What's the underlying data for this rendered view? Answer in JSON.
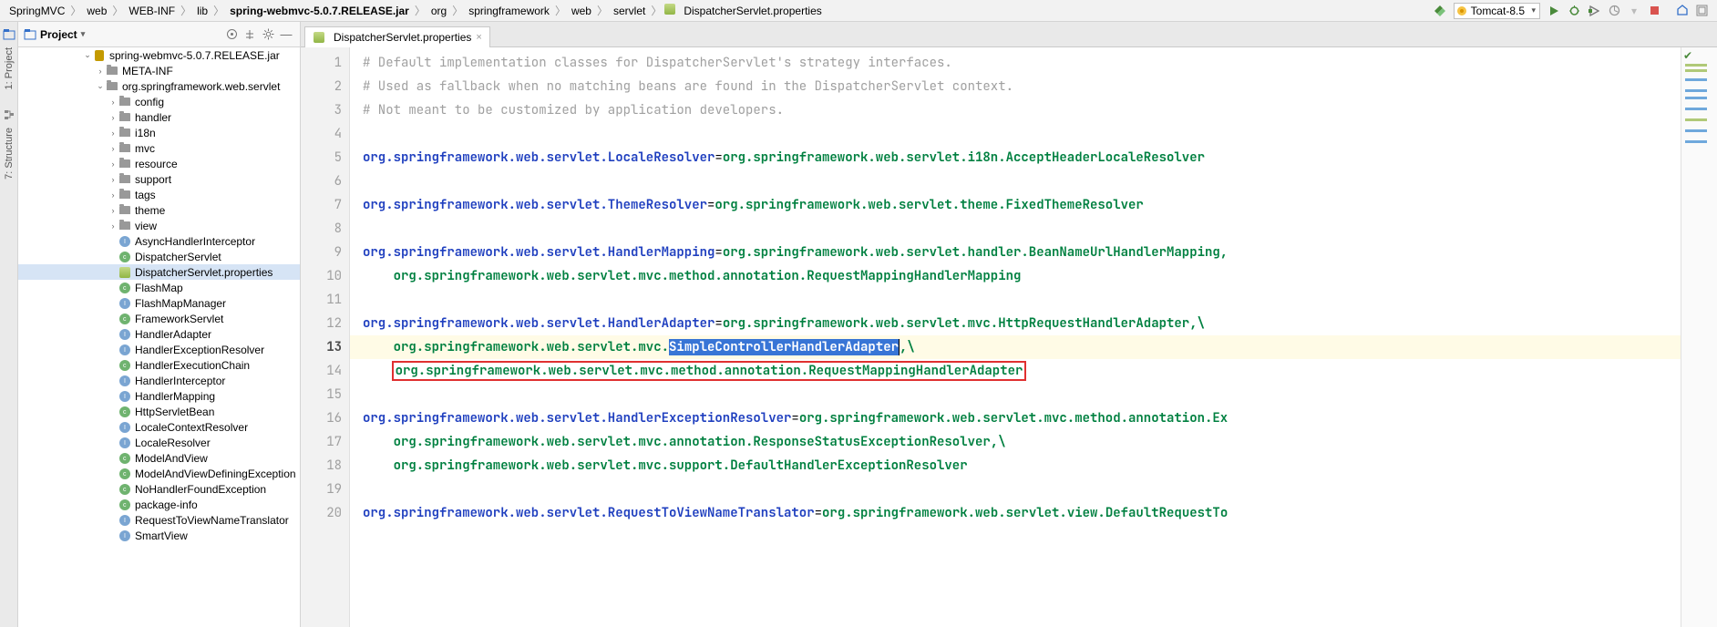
{
  "breadcrumb": [
    "SpringMVC",
    "web",
    "WEB-INF",
    "lib",
    "spring-webmvc-5.0.7.RELEASE.jar",
    "org",
    "springframework",
    "web",
    "servlet",
    "DispatcherServlet.properties"
  ],
  "breadcrumb_bold_index": 4,
  "run_config": "Tomcat-8.5",
  "sidebar": {
    "title": "Project",
    "vtabs": [
      "1: Project",
      "7: Structure"
    ],
    "tree": [
      {
        "d": 5,
        "tw": "v",
        "ico": "jar",
        "lbl": "spring-webmvc-5.0.7.RELEASE.jar"
      },
      {
        "d": 6,
        "tw": ">",
        "ico": "folder",
        "lbl": "META-INF"
      },
      {
        "d": 6,
        "tw": "v",
        "ico": "folder",
        "lbl": "org.springframework.web.servlet"
      },
      {
        "d": 7,
        "tw": ">",
        "ico": "folder",
        "lbl": "config"
      },
      {
        "d": 7,
        "tw": ">",
        "ico": "folder",
        "lbl": "handler"
      },
      {
        "d": 7,
        "tw": ">",
        "ico": "folder",
        "lbl": "i18n"
      },
      {
        "d": 7,
        "tw": ">",
        "ico": "folder",
        "lbl": "mvc"
      },
      {
        "d": 7,
        "tw": ">",
        "ico": "folder",
        "lbl": "resource"
      },
      {
        "d": 7,
        "tw": ">",
        "ico": "folder",
        "lbl": "support"
      },
      {
        "d": 7,
        "tw": ">",
        "ico": "folder",
        "lbl": "tags"
      },
      {
        "d": 7,
        "tw": ">",
        "ico": "folder",
        "lbl": "theme"
      },
      {
        "d": 7,
        "tw": ">",
        "ico": "folder",
        "lbl": "view"
      },
      {
        "d": 7,
        "tw": "",
        "ico": "clsi",
        "lbl": "AsyncHandlerInterceptor"
      },
      {
        "d": 7,
        "tw": "",
        "ico": "cls",
        "lbl": "DispatcherServlet"
      },
      {
        "d": 7,
        "tw": "",
        "ico": "props",
        "lbl": "DispatcherServlet.properties",
        "sel": true
      },
      {
        "d": 7,
        "tw": "",
        "ico": "cls",
        "lbl": "FlashMap"
      },
      {
        "d": 7,
        "tw": "",
        "ico": "clsi",
        "lbl": "FlashMapManager"
      },
      {
        "d": 7,
        "tw": "",
        "ico": "cls",
        "lbl": "FrameworkServlet"
      },
      {
        "d": 7,
        "tw": "",
        "ico": "clsi",
        "lbl": "HandlerAdapter"
      },
      {
        "d": 7,
        "tw": "",
        "ico": "clsi",
        "lbl": "HandlerExceptionResolver"
      },
      {
        "d": 7,
        "tw": "",
        "ico": "cls",
        "lbl": "HandlerExecutionChain"
      },
      {
        "d": 7,
        "tw": "",
        "ico": "clsi",
        "lbl": "HandlerInterceptor"
      },
      {
        "d": 7,
        "tw": "",
        "ico": "clsi",
        "lbl": "HandlerMapping"
      },
      {
        "d": 7,
        "tw": "",
        "ico": "cls",
        "lbl": "HttpServletBean"
      },
      {
        "d": 7,
        "tw": "",
        "ico": "clsi",
        "lbl": "LocaleContextResolver"
      },
      {
        "d": 7,
        "tw": "",
        "ico": "clsi",
        "lbl": "LocaleResolver"
      },
      {
        "d": 7,
        "tw": "",
        "ico": "cls",
        "lbl": "ModelAndView"
      },
      {
        "d": 7,
        "tw": "",
        "ico": "cls",
        "lbl": "ModelAndViewDefiningException"
      },
      {
        "d": 7,
        "tw": "",
        "ico": "cls",
        "lbl": "NoHandlerFoundException"
      },
      {
        "d": 7,
        "tw": "",
        "ico": "cls",
        "lbl": "package-info"
      },
      {
        "d": 7,
        "tw": "",
        "ico": "clsi",
        "lbl": "RequestToViewNameTranslator"
      },
      {
        "d": 7,
        "tw": "",
        "ico": "clsi",
        "lbl": "SmartView"
      }
    ]
  },
  "editor": {
    "tab_label": "DispatcherServlet.properties",
    "current_line": 13,
    "lines": [
      {
        "n": 1,
        "cmt": "# Default implementation classes for DispatcherServlet's strategy interfaces."
      },
      {
        "n": 2,
        "cmt": "# Used as fallback when no matching beans are found in the DispatcherServlet context."
      },
      {
        "n": 3,
        "cmt": "# Not meant to be customized by application developers."
      },
      {
        "n": 4,
        "blank": true
      },
      {
        "n": 5,
        "key": "org.springframework.web.servlet.LocaleResolver",
        "eq": "=",
        "val": "org.springframework.web.servlet.i18n.AcceptHeaderLocaleResolver"
      },
      {
        "n": 6,
        "blank": true
      },
      {
        "n": 7,
        "key": "org.springframework.web.servlet.ThemeResolver",
        "eq": "=",
        "val": "org.springframework.web.servlet.theme.FixedThemeResolver"
      },
      {
        "n": 8,
        "blank": true
      },
      {
        "n": 9,
        "key": "org.springframework.web.servlet.HandlerMapping",
        "eq": "=",
        "val": "org.springframework.web.servlet.handler.BeanNameUrlHandlerMapping,"
      },
      {
        "n": 10,
        "cont": true,
        "val": "org.springframework.web.servlet.mvc.method.annotation.RequestMappingHandlerMapping"
      },
      {
        "n": 11,
        "blank": true
      },
      {
        "n": 12,
        "key": "org.springframework.web.servlet.HandlerAdapter",
        "eq": "=",
        "val": "org.springframework.web.servlet.mvc.HttpRequestHandlerAdapter,\\"
      },
      {
        "n": 13,
        "cont": true,
        "val_pre": "org.springframework.web.servlet.mvc.",
        "val_sel": "SimpleControllerHandlerAdapter",
        "val_post": ",\\",
        "current": true
      },
      {
        "n": 14,
        "cont": true,
        "val": "org.springframework.web.servlet.mvc.method.annotation.RequestMappingHandlerAdapter",
        "boxed": true
      },
      {
        "n": 15,
        "blank": true
      },
      {
        "n": 16,
        "key": "org.springframework.web.servlet.HandlerExceptionResolver",
        "eq": "=",
        "val": "org.springframework.web.servlet.mvc.method.annotation.Ex"
      },
      {
        "n": 17,
        "cont": true,
        "val": "org.springframework.web.servlet.mvc.annotation.ResponseStatusExceptionResolver,\\"
      },
      {
        "n": 18,
        "cont": true,
        "val": "org.springframework.web.servlet.mvc.support.DefaultHandlerExceptionResolver"
      },
      {
        "n": 19,
        "blank": true
      },
      {
        "n": 20,
        "key": "org.springframework.web.servlet.RequestToViewNameTranslator",
        "eq": "=",
        "val": "org.springframework.web.servlet.view.DefaultRequestTo"
      }
    ]
  },
  "colors": {
    "green": "#008040",
    "blue": "#1f3fbf",
    "grey": "#a0a0a0",
    "sel": "#3875d6",
    "box": "#e03030"
  }
}
